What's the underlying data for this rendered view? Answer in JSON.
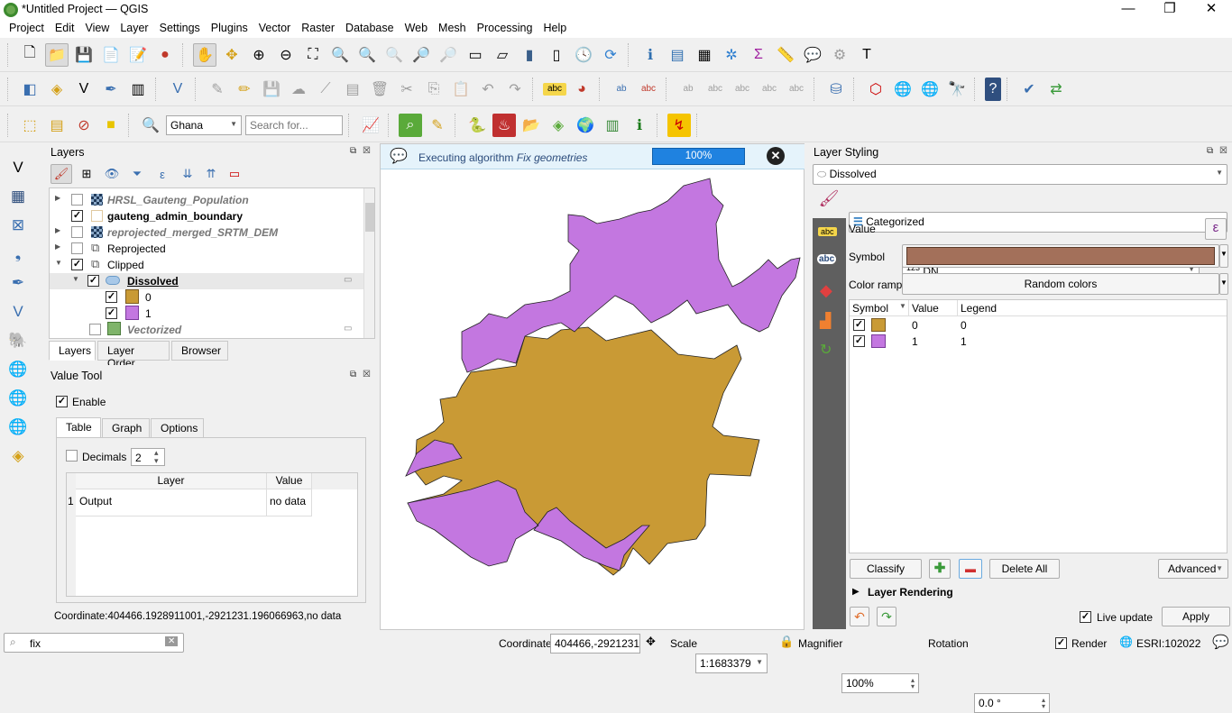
{
  "window": {
    "title": "*Untitled Project — QGIS",
    "minimize": "—",
    "restore": "❐",
    "close": "✕"
  },
  "menu": [
    "Project",
    "Edit",
    "View",
    "Layer",
    "Settings",
    "Plugins",
    "Vector",
    "Raster",
    "Database",
    "Web",
    "Mesh",
    "Processing",
    "Help"
  ],
  "toolbar": {
    "locator_combo": "Ghana",
    "search_placeholder": "Search for..."
  },
  "layers_panel": {
    "title": "Layers",
    "tabs": [
      "Layers",
      "Layer Order",
      "Browser"
    ],
    "items": [
      {
        "name": "HRSL_Gauteng_Population",
        "checked": false,
        "style": "italic-gray",
        "icon": "raster"
      },
      {
        "name": "gauteng_admin_boundary",
        "checked": true,
        "style": "bold",
        "icon": "polygon-empty"
      },
      {
        "name": "reprojected_merged_SRTM_DEM",
        "checked": false,
        "style": "italic-gray",
        "icon": "raster"
      },
      {
        "name": "Reprojected",
        "checked": false,
        "style": "normal",
        "icon": "group"
      },
      {
        "name": "Clipped",
        "checked": true,
        "style": "normal",
        "icon": "group"
      },
      {
        "name": "Dissolved",
        "checked": true,
        "style": "bold-underline",
        "icon": "polygon"
      },
      {
        "name": "0",
        "checked": true,
        "style": "normal",
        "color": "#c99a35"
      },
      {
        "name": "1",
        "checked": true,
        "style": "normal",
        "color": "#c377e0"
      },
      {
        "name": "Vectorized",
        "checked": false,
        "style": "italic-gray",
        "color": "#7fb46a"
      }
    ]
  },
  "value_tool": {
    "title": "Value Tool",
    "enable_label": "Enable",
    "tabs": [
      "Table",
      "Graph",
      "Options"
    ],
    "decimals_label": "Decimals",
    "decimals_value": "2",
    "table_headers": [
      "Layer",
      "Value"
    ],
    "rows": [
      {
        "index": "1",
        "layer": "Output",
        "value": "no data"
      }
    ],
    "coordinate": "Coordinate:404466.1928911001,-2921231.196066963,no data"
  },
  "message_bar": {
    "text": "Executing algorithm ",
    "algorithm": "Fix geometries",
    "progress_label": "100%",
    "progress": 100
  },
  "map": {
    "class0_color": "#c99a35",
    "class1_color": "#c377e0"
  },
  "styling": {
    "title": "Layer Styling",
    "layer": "Dissolved",
    "renderer": "Categorized",
    "value_label": "Value",
    "value_field": "DN",
    "value_type": "123",
    "symbol_label": "Symbol",
    "symbol_color": "#a3705a",
    "ramp_label": "Color ramp",
    "ramp_value": "Random colors",
    "table_headers": [
      "Symbol",
      "Value",
      "Legend"
    ],
    "categories": [
      {
        "value": "0",
        "legend": "0",
        "color": "#c99a35"
      },
      {
        "value": "1",
        "legend": "1",
        "color": "#c377e0"
      }
    ],
    "classify": "Classify",
    "delete_all": "Delete All",
    "advanced": "Advanced",
    "layer_rendering": "Layer Rendering",
    "live_update": "Live update",
    "apply": "Apply"
  },
  "status": {
    "locator_value": "fix",
    "coordinate_label": "Coordinate",
    "coordinate_value": "404466,-2921231",
    "scale_label": "Scale",
    "scale_value": "1:1683379",
    "magnifier_label": "Magnifier",
    "magnifier_value": "100%",
    "rotation_label": "Rotation",
    "rotation_value": "0.0 °",
    "render_label": "Render",
    "crs": "ESRI:102022"
  }
}
